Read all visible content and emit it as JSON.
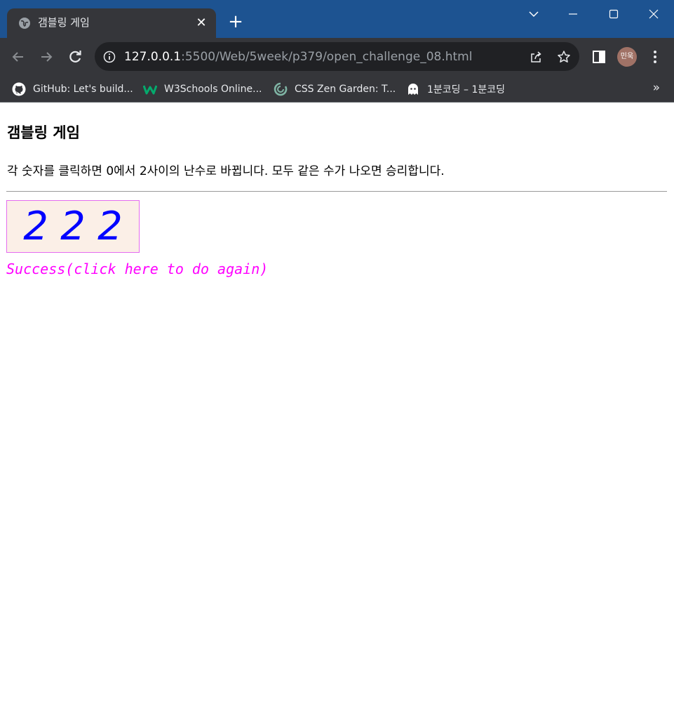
{
  "browser": {
    "tab_title": "갬블링 게임",
    "tab_close": "✕",
    "new_tab": "+",
    "url_host": "127.0.0.1",
    "url_path": ":5500/Web/5week/p379/open_challenge_08.html",
    "profile_label": "민욱",
    "bookmarks": [
      {
        "label": "GitHub: Let's build...",
        "icon": "github-icon"
      },
      {
        "label": "W3Schools Online...",
        "icon": "w3schools-icon"
      },
      {
        "label": "CSS Zen Garden: T...",
        "icon": "zen-garden-icon"
      },
      {
        "label": "1분코딩 – 1분코딩",
        "icon": "ghost-icon"
      }
    ],
    "bookmarks_overflow": "»",
    "colors": {
      "titlebar": "#1d5391",
      "toolbar": "#35363a",
      "omnibox": "#202124"
    }
  },
  "page": {
    "title": "갬블링 게임",
    "description": "각 숫자를 클릭하면 0에서 2사이의 난수로 바뀝니다. 모두 같은 수가 나오면 승리합니다.",
    "digits": [
      "2",
      "2",
      "2"
    ],
    "result_text": "Success(click here to do again)",
    "colors": {
      "digit": "#0000ff",
      "box_bg": "#fbefe7",
      "box_border": "#e46cf0",
      "result": "#ff00ff"
    }
  }
}
